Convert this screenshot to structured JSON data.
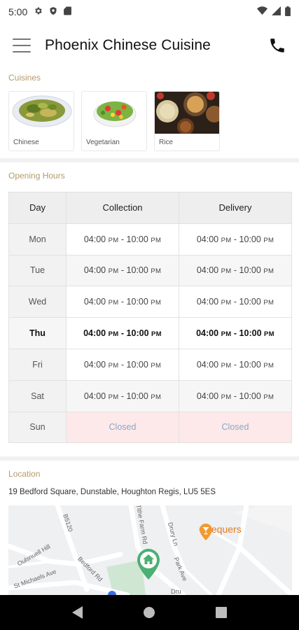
{
  "status_bar": {
    "time": "5:00"
  },
  "app": {
    "title": "Phoenix Chinese Cuisine"
  },
  "cuisines": {
    "title": "Cuisines",
    "items": [
      {
        "label": "Chinese",
        "icon": "chinese-dish-image"
      },
      {
        "label": "Vegetarian",
        "icon": "vegetarian-dish-image"
      },
      {
        "label": "Rice",
        "icon": "rice-dish-image"
      }
    ]
  },
  "opening_hours": {
    "title": "Opening Hours",
    "headers": {
      "day": "Day",
      "collection": "Collection",
      "delivery": "Delivery"
    },
    "rows": [
      {
        "day": "Mon",
        "collection": {
          "from": "04:00",
          "from_ampm": "PM",
          "to": "10:00",
          "to_ampm": "PM"
        },
        "delivery": {
          "from": "04:00",
          "from_ampm": "PM",
          "to": "10:00",
          "to_ampm": "PM"
        }
      },
      {
        "day": "Tue",
        "collection": {
          "from": "04:00",
          "from_ampm": "PM",
          "to": "10:00",
          "to_ampm": "PM"
        },
        "delivery": {
          "from": "04:00",
          "from_ampm": "PM",
          "to": "10:00",
          "to_ampm": "PM"
        }
      },
      {
        "day": "Wed",
        "collection": {
          "from": "04:00",
          "from_ampm": "PM",
          "to": "10:00",
          "to_ampm": "PM"
        },
        "delivery": {
          "from": "04:00",
          "from_ampm": "PM",
          "to": "10:00",
          "to_ampm": "PM"
        }
      },
      {
        "day": "Thu",
        "collection": {
          "from": "04:00",
          "from_ampm": "PM",
          "to": "10:00",
          "to_ampm": "PM"
        },
        "delivery": {
          "from": "04:00",
          "from_ampm": "PM",
          "to": "10:00",
          "to_ampm": "PM"
        }
      },
      {
        "day": "Fri",
        "collection": {
          "from": "04:00",
          "from_ampm": "PM",
          "to": "10:00",
          "to_ampm": "PM"
        },
        "delivery": {
          "from": "04:00",
          "from_ampm": "PM",
          "to": "10:00",
          "to_ampm": "PM"
        }
      },
      {
        "day": "Sat",
        "collection": {
          "from": "04:00",
          "from_ampm": "PM",
          "to": "10:00",
          "to_ampm": "PM"
        },
        "delivery": {
          "from": "04:00",
          "from_ampm": "PM",
          "to": "10:00",
          "to_ampm": "PM"
        }
      },
      {
        "day": "Sun",
        "collection_closed": "Closed",
        "delivery_closed": "Closed"
      }
    ]
  },
  "location": {
    "title": "Location",
    "address": "19 Bedford Square, Dunstable, Houghton Regis, LU5 5ES",
    "map": {
      "poi": "Chequers",
      "streets": [
        "B5120",
        "Tithe Farm Rd",
        "Drury Ln",
        "Park Ave",
        "Bedford Rd",
        "St Michaels Ave",
        "Tithe Farm Rd"
      ],
      "partial_labels": [
        "Oulsnuell Hill",
        "Dru"
      ]
    }
  },
  "colors": {
    "accent_label": "#b49a6a",
    "closed_bg": "#fde9ea",
    "closed_text": "#8aa8c4",
    "map_pin": "#4caf73",
    "poi": "#e07b22"
  }
}
